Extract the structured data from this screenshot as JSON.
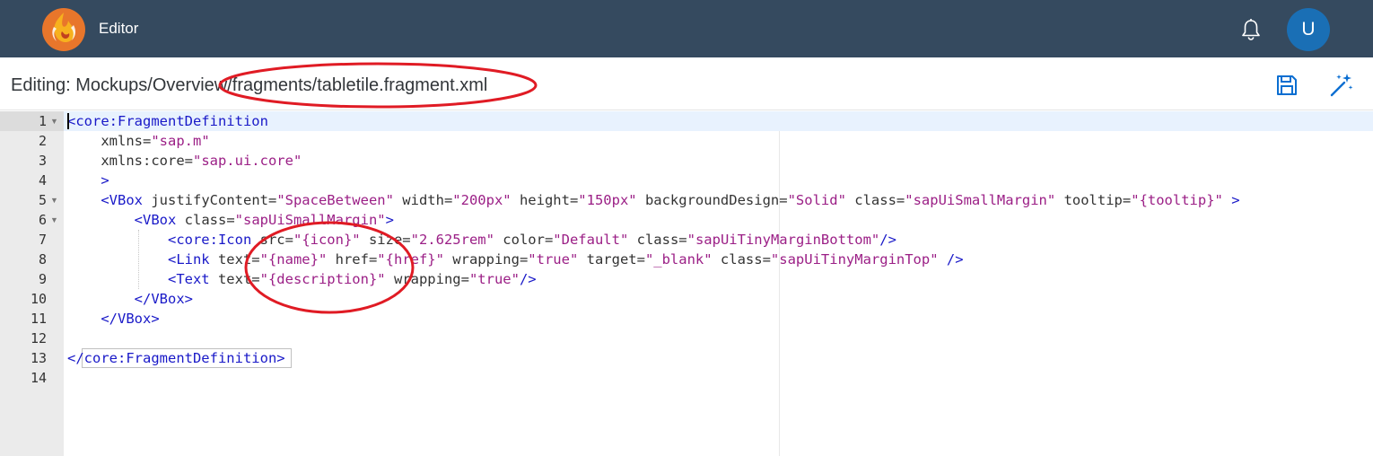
{
  "app": {
    "title": "Editor",
    "user_initial": "U"
  },
  "icons": {
    "logo": "phoenix-logo-icon",
    "bell": "bell-icon",
    "save": "save-icon",
    "magic": "magic-wand-icon"
  },
  "subheader": {
    "path": "Editing: Mockups/Overview/fragments/tabletile.fragment.xml"
  },
  "editor": {
    "line_numbers": [
      "1",
      "2",
      "3",
      "4",
      "5",
      "6",
      "7",
      "8",
      "9",
      "10",
      "11",
      "12",
      "13",
      "14"
    ],
    "lines": [
      [
        {
          "t": "<core:FragmentDefinition",
          "c": "tag"
        }
      ],
      [
        {
          "t": "    xmlns=",
          "c": "attr"
        },
        {
          "t": "\"sap.m\"",
          "c": "str"
        }
      ],
      [
        {
          "t": "    xmlns:core=",
          "c": "attr"
        },
        {
          "t": "\"sap.ui.core\"",
          "c": "str"
        }
      ],
      [
        {
          "t": "    >",
          "c": "tag"
        }
      ],
      [
        {
          "t": "    <VBox",
          "c": "tag"
        },
        {
          "t": " justifyContent=",
          "c": "attr"
        },
        {
          "t": "\"SpaceBetween\"",
          "c": "str"
        },
        {
          "t": " width=",
          "c": "attr"
        },
        {
          "t": "\"200px\"",
          "c": "str"
        },
        {
          "t": " height=",
          "c": "attr"
        },
        {
          "t": "\"150px\"",
          "c": "str"
        },
        {
          "t": " backgroundDesign=",
          "c": "attr"
        },
        {
          "t": "\"Solid\"",
          "c": "str"
        },
        {
          "t": " class=",
          "c": "attr"
        },
        {
          "t": "\"sapUiSmallMargin\"",
          "c": "str"
        },
        {
          "t": " tooltip=",
          "c": "attr"
        },
        {
          "t": "\"{tooltip}\"",
          "c": "str"
        },
        {
          "t": " >",
          "c": "tag"
        }
      ],
      [
        {
          "t": "        <VBox",
          "c": "tag"
        },
        {
          "t": " class=",
          "c": "attr"
        },
        {
          "t": "\"sapUiSmallMargin\"",
          "c": "str"
        },
        {
          "t": ">",
          "c": "tag"
        }
      ],
      [
        {
          "t": "            <core:Icon",
          "c": "tag"
        },
        {
          "t": " src=",
          "c": "attr"
        },
        {
          "t": "\"{icon}\"",
          "c": "str"
        },
        {
          "t": " size=",
          "c": "attr"
        },
        {
          "t": "\"2.625rem\"",
          "c": "str"
        },
        {
          "t": " color=",
          "c": "attr"
        },
        {
          "t": "\"Default\"",
          "c": "str"
        },
        {
          "t": " class=",
          "c": "attr"
        },
        {
          "t": "\"sapUiTinyMarginBottom\"",
          "c": "str"
        },
        {
          "t": "/>",
          "c": "tag"
        }
      ],
      [
        {
          "t": "            <Link",
          "c": "tag"
        },
        {
          "t": " text=",
          "c": "attr"
        },
        {
          "t": "\"{name}\"",
          "c": "str"
        },
        {
          "t": " href=",
          "c": "attr"
        },
        {
          "t": "\"{href}\"",
          "c": "str"
        },
        {
          "t": " wrapping=",
          "c": "attr"
        },
        {
          "t": "\"true\"",
          "c": "str"
        },
        {
          "t": " target=",
          "c": "attr"
        },
        {
          "t": "\"_blank\"",
          "c": "str"
        },
        {
          "t": " class=",
          "c": "attr"
        },
        {
          "t": "\"sapUiTinyMarginTop\"",
          "c": "str"
        },
        {
          "t": " />",
          "c": "tag"
        }
      ],
      [
        {
          "t": "            <Text",
          "c": "tag"
        },
        {
          "t": " text=",
          "c": "attr"
        },
        {
          "t": "\"{description}\"",
          "c": "str"
        },
        {
          "t": " wrapping=",
          "c": "attr"
        },
        {
          "t": "\"true\"",
          "c": "str"
        },
        {
          "t": "/>",
          "c": "tag"
        }
      ],
      [
        {
          "t": "        </VBox>",
          "c": "tag"
        }
      ],
      [
        {
          "t": "    </VBox>",
          "c": "tag"
        }
      ],
      [],
      [
        {
          "t": "</core:FragmentDefinition>",
          "c": "tag"
        }
      ],
      []
    ],
    "fold_lines": [
      1,
      5,
      6
    ]
  }
}
